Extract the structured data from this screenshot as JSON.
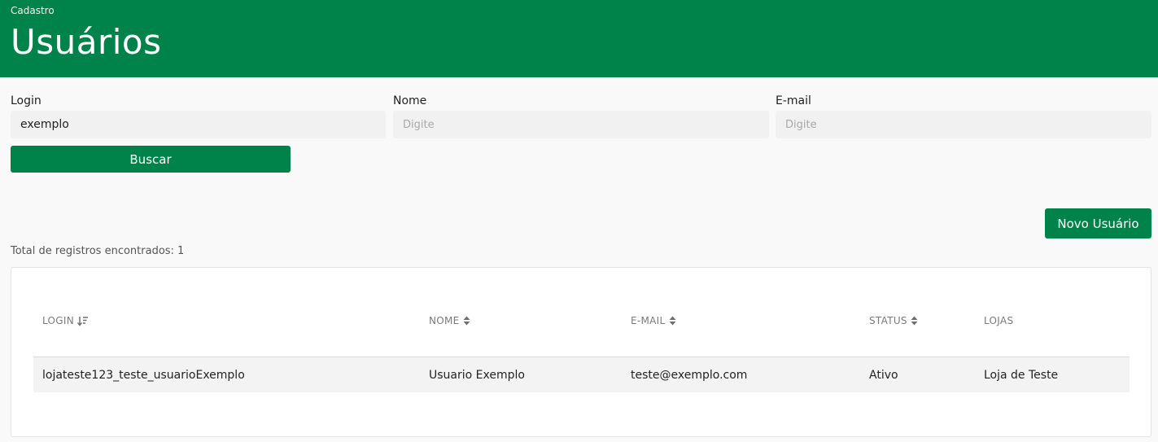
{
  "header": {
    "breadcrumb": "Cadastro",
    "title": "Usuários"
  },
  "filters": {
    "login": {
      "label": "Login",
      "value": "exemplo",
      "placeholder": "Digite"
    },
    "nome": {
      "label": "Nome",
      "value": "",
      "placeholder": "Digite"
    },
    "email": {
      "label": "E-mail",
      "value": "",
      "placeholder": "Digite"
    },
    "search_label": "Buscar"
  },
  "actions": {
    "new_user_label": "Novo Usuário"
  },
  "results": {
    "total_text": "Total de registros encontrados: 1"
  },
  "table": {
    "columns": [
      {
        "label": "LOGIN",
        "sort_icon": "sort-descending-icon"
      },
      {
        "label": "NOME",
        "sort_icon": "sort-icon"
      },
      {
        "label": "E-MAIL",
        "sort_icon": "sort-icon"
      },
      {
        "label": "STATUS",
        "sort_icon": "sort-icon"
      },
      {
        "label": "LOJAS",
        "sort_icon": ""
      }
    ],
    "rows": [
      [
        "lojateste123_teste_usuarioExemplo",
        "Usuario Exemplo",
        "teste@exemplo.com",
        "Ativo",
        "Loja de Teste"
      ]
    ]
  },
  "colors": {
    "brand_green": "#00834b",
    "background": "#f9f9f9",
    "input_background": "#f1f1f1"
  }
}
